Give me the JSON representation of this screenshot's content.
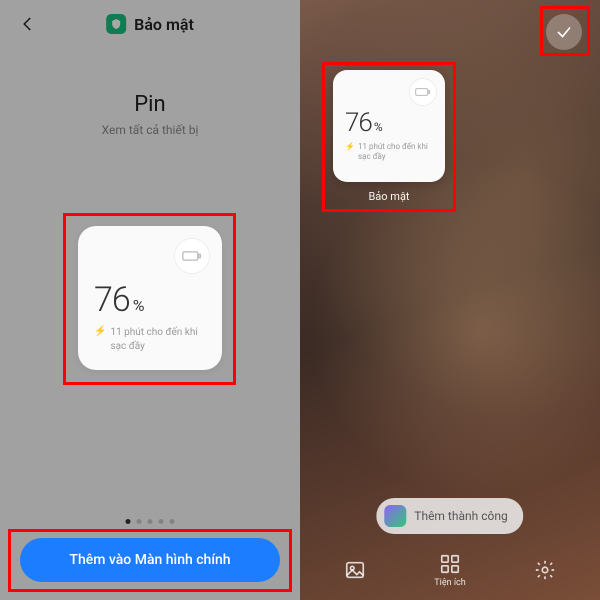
{
  "left": {
    "header": {
      "title": "Bảo mật"
    },
    "section": {
      "title": "Pin",
      "subtitle": "Xem tất cả thiết bị"
    },
    "widget": {
      "percent": "76",
      "percent_symbol": "%",
      "status": "11 phút cho đến khi sạc đầy"
    },
    "cta_label": "Thêm vào Màn hình chính"
  },
  "right": {
    "widget": {
      "percent": "76",
      "percent_symbol": "%",
      "status": "11 phút cho đến khi sạc đầy",
      "caption": "Bảo mật"
    },
    "toast": "Thêm thành công",
    "dock": {
      "utilities": "Tiện ích"
    }
  }
}
